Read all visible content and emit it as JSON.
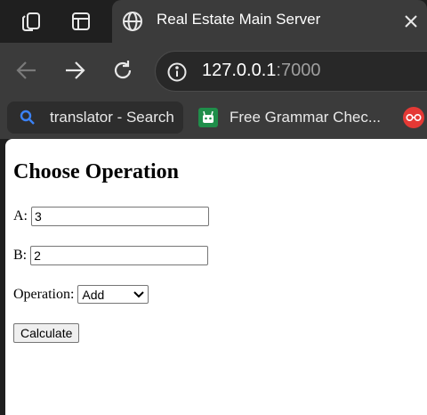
{
  "browser": {
    "tab_title": "Real Estate Main Server",
    "url_host": "127.0.0.1",
    "url_port": ":7000",
    "bookmarks": [
      {
        "label": "translator - Search"
      },
      {
        "label": "Free Grammar Chec..."
      }
    ]
  },
  "form": {
    "heading": "Choose Operation",
    "a_label": "A:",
    "a_value": "3",
    "b_label": "B:",
    "b_value": "2",
    "operation_label": "Operation:",
    "operation_selected": "Add",
    "calculate_label": "Calculate"
  },
  "colors": {
    "chrome_dark": "#1f1f1f",
    "chrome_toolbar": "#3b3b3b",
    "bookmark_search_icon": "#3b82f6",
    "bookmark_grammar_icon": "#1f8e4a",
    "extension_icon": "#e53935"
  }
}
